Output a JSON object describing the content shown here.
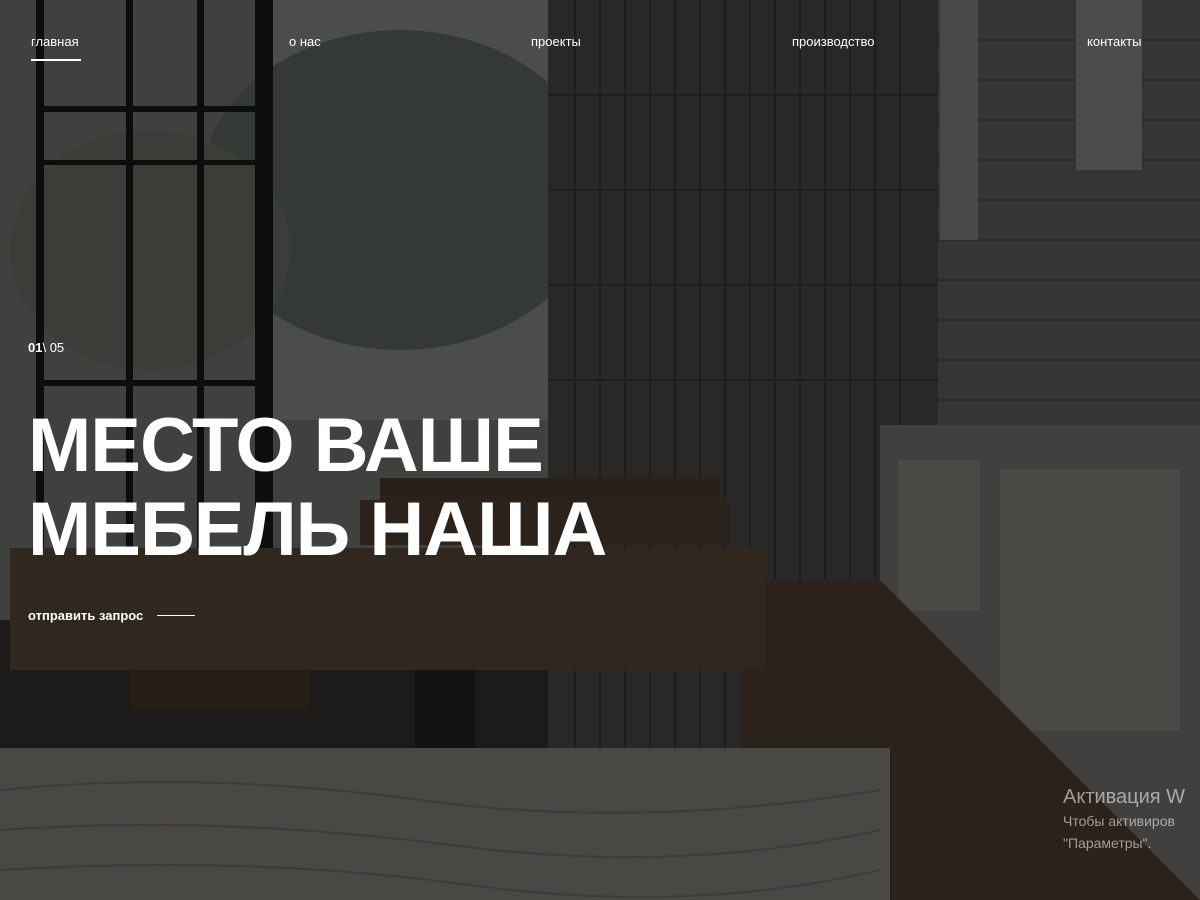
{
  "nav": {
    "items": [
      {
        "label": "главная",
        "active": true
      },
      {
        "label": "о нас",
        "active": false
      },
      {
        "label": "проекты",
        "active": false
      },
      {
        "label": "производство",
        "active": false
      },
      {
        "label": "контакты",
        "active": false
      }
    ]
  },
  "slider": {
    "current": "01",
    "separator": "\\",
    "total": " 05"
  },
  "hero": {
    "title_line1": "МЕСТО ВАШЕ",
    "title_line2": "МЕБЕЛЬ НАША",
    "cta_label": "отправить запрос"
  },
  "watermark": {
    "title": "Активация W",
    "line1": "Чтобы активиров",
    "line2": "\"Параметры\"."
  },
  "colors": {
    "text": "#ffffff",
    "overlay": "rgba(0,0,0,0.30)"
  }
}
